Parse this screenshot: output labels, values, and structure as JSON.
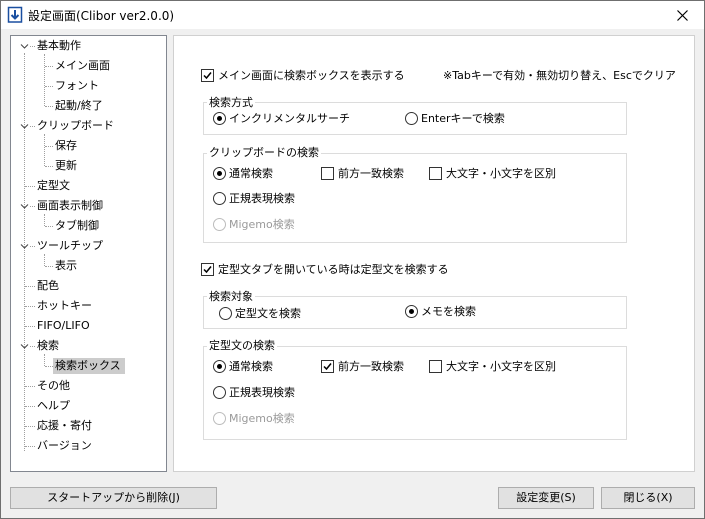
{
  "window": {
    "title": "設定画面(Clibor ver2.0.0)"
  },
  "tree": {
    "items": [
      {
        "label": "基本動作"
      },
      {
        "label": "メイン画面"
      },
      {
        "label": "フォント"
      },
      {
        "label": "起動/終了"
      },
      {
        "label": "クリップボード"
      },
      {
        "label": "保存"
      },
      {
        "label": "更新"
      },
      {
        "label": "定型文"
      },
      {
        "label": "画面表示制御"
      },
      {
        "label": "タブ制御"
      },
      {
        "label": "ツールチップ"
      },
      {
        "label": "表示"
      },
      {
        "label": "配色"
      },
      {
        "label": "ホットキー"
      },
      {
        "label": "FIFO/LIFO"
      },
      {
        "label": "検索"
      },
      {
        "label": "検索ボックス"
      },
      {
        "label": "その他"
      },
      {
        "label": "ヘルプ"
      },
      {
        "label": "応援・寄付"
      },
      {
        "label": "バージョン"
      }
    ]
  },
  "settings": {
    "show_search_box": {
      "label": "メイン画面に検索ボックスを表示する",
      "checked": true
    },
    "hint": "※Tabキーで有効・無効切り替え、Escでクリア",
    "search_method": {
      "title": "検索方式",
      "incremental": {
        "label": "インクリメンタルサーチ",
        "selected": true
      },
      "enter": {
        "label": "Enterキーで検索",
        "selected": false
      }
    },
    "clipboard_search": {
      "title": "クリップボードの検索",
      "normal": {
        "label": "通常検索",
        "selected": true
      },
      "prefix": {
        "label": "前方一致検索",
        "checked": false
      },
      "case": {
        "label": "大文字・小文字を区別",
        "checked": false
      },
      "regex": {
        "label": "正規表現検索",
        "selected": false
      },
      "migemo": {
        "label": "Migemo検索",
        "selected": false,
        "disabled": true
      }
    },
    "template_tab_search": {
      "label": "定型文タブを開いている時は定型文を検索する",
      "checked": true
    },
    "search_target": {
      "title": "検索対象",
      "template": {
        "label": "定型文を検索",
        "selected": false
      },
      "memo": {
        "label": "メモを検索",
        "selected": true
      }
    },
    "template_search": {
      "title": "定型文の検索",
      "normal": {
        "label": "通常検索",
        "selected": true
      },
      "prefix": {
        "label": "前方一致検索",
        "checked": true
      },
      "case": {
        "label": "大文字・小文字を区別",
        "checked": false
      },
      "regex": {
        "label": "正規表現検索",
        "selected": false
      },
      "migemo": {
        "label": "Migemo検索",
        "selected": false,
        "disabled": true
      }
    }
  },
  "buttons": {
    "remove_startup": "スタートアップから削除(J)",
    "apply": "設定変更(S)",
    "close": "閉じる(X)"
  },
  "colors": {
    "accent": "#1a4fa0",
    "selection": "#cccccc"
  }
}
